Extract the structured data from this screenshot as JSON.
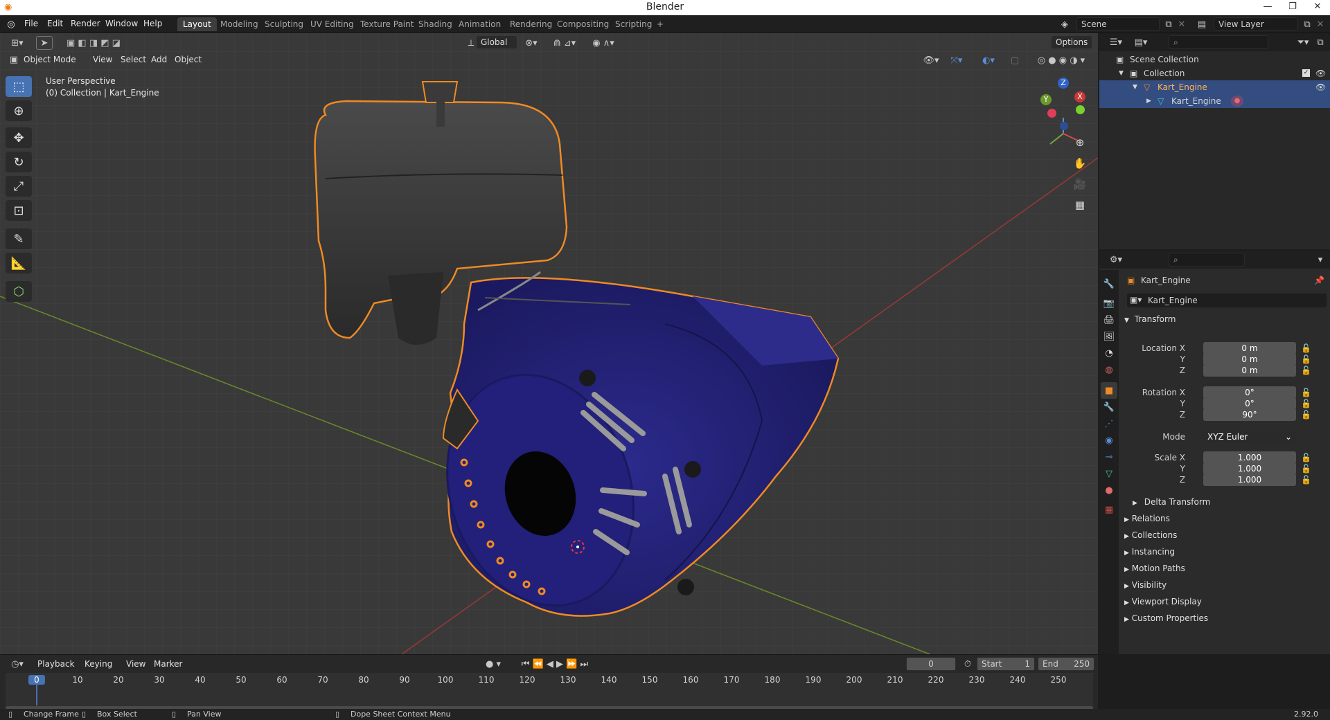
{
  "titlebar": {
    "title": "Blender",
    "minimize": "—",
    "restore": "❐",
    "close": "✕"
  },
  "menus": [
    "File",
    "Edit",
    "Render",
    "Window",
    "Help"
  ],
  "workspaces": [
    "Layout",
    "Modeling",
    "Sculpting",
    "UV Editing",
    "Texture Paint",
    "Shading",
    "Animation",
    "Rendering",
    "Compositing",
    "Scripting"
  ],
  "workspace_add": "+",
  "scene": {
    "name": "Scene",
    "view_layer": "View Layer"
  },
  "viewport": {
    "orientation": "Global",
    "options": "Options",
    "mode": "Object Mode",
    "header_menus": [
      "View",
      "Select",
      "Add",
      "Object"
    ],
    "overlay_title": "User Perspective",
    "overlay_sub": "(0) Collection | Kart_Engine",
    "gizmo": {
      "x": "X",
      "y": "Y",
      "z": "Z"
    },
    "accent": "#f08a24",
    "engine_color": "#25237a"
  },
  "outliner": {
    "scene_collection": "Scene Collection",
    "collection": "Collection",
    "object": "Kart_Engine",
    "mesh": "Kart_Engine"
  },
  "properties": {
    "object_name": "Kart_Engine",
    "datablock": "Kart_Engine",
    "transform": "Transform",
    "location_label": "Location X",
    "rotation_label": "Rotation X",
    "scale_label": "Scale X",
    "y": "Y",
    "z": "Z",
    "location": [
      "0 m",
      "0 m",
      "0 m"
    ],
    "rotation": [
      "0°",
      "0°",
      "90°"
    ],
    "mode_label": "Mode",
    "mode_value": "XYZ Euler",
    "scale": [
      "1.000",
      "1.000",
      "1.000"
    ],
    "delta": "Delta Transform",
    "panels": [
      "Relations",
      "Collections",
      "Instancing",
      "Motion Paths",
      "Visibility",
      "Viewport Display",
      "Custom Properties"
    ]
  },
  "timeline": {
    "menus": [
      "Playback",
      "Keying",
      "View",
      "Marker"
    ],
    "current_frame": "0",
    "start_label": "Start",
    "start": "1",
    "end_label": "End",
    "end": "250",
    "ticks": [
      "0",
      "10",
      "20",
      "30",
      "40",
      "50",
      "60",
      "70",
      "80",
      "90",
      "100",
      "110",
      "120",
      "130",
      "140",
      "150",
      "160",
      "170",
      "180",
      "190",
      "200",
      "210",
      "220",
      "230",
      "240",
      "250"
    ]
  },
  "statusbar": {
    "change_frame": "Change Frame",
    "box_select": "Box Select",
    "pan_view": "Pan View",
    "context_menu": "Dope Sheet Context Menu",
    "version": "2.92.0"
  }
}
